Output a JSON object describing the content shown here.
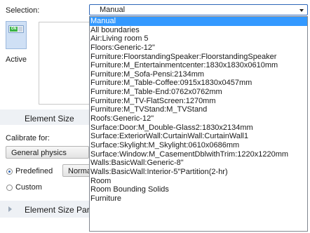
{
  "selection": {
    "label": "Selection:",
    "value": "Manual",
    "options": [
      "Manual",
      "All boundaries",
      "Air:Living room 5",
      "Floors:Generic-12\"",
      "Furniture:FloorstandingSpeaker:FloorstandingSpeaker",
      "Furniture:M_Entertainmentcenter:1830x1830x0610mm",
      "Furniture:M_Sofa-Pensi:2134mm",
      "Furniture:M_Table-Coffee:0915x1830x0457mm",
      "Furniture:M_Table-End:0762x0762mm",
      "Furniture:M_TV-FlatScreen:1270mm",
      "Furniture:M_TVStand:M_TVStand",
      "Roofs:Generic-12\"",
      "Surface:Door:M_Double-Glass2:1830x2134mm",
      "Surface:ExteriorWall:CurtainWall:CurtainWall1",
      "Surface:Skylight:M_Skylight:0610x0686mm",
      "Surface:Window:M_CasementDblwithTrim:1220x1220mm",
      "Walls:BasicWall:Generic-8\"",
      "Walls:BasicWall:Interior-5\"Partition(2-hr)",
      "Room",
      "Room Bounding  Solids",
      "Furniture"
    ],
    "selected_index": 0
  },
  "active": {
    "toggle_text": "ON",
    "label": "Active"
  },
  "element_size": {
    "title": "Element Size",
    "calibrate_label": "Calibrate for:",
    "calibrate_value": "General physics",
    "predefined_label": "Predefined",
    "normal_button": "Normal",
    "custom_label": "Custom"
  },
  "element_size_params": {
    "title": "Element Size Parameters"
  },
  "colors": {
    "highlight": "#3399ff",
    "toggle_on": "#3ab345",
    "combo_border": "#2f67b8"
  }
}
